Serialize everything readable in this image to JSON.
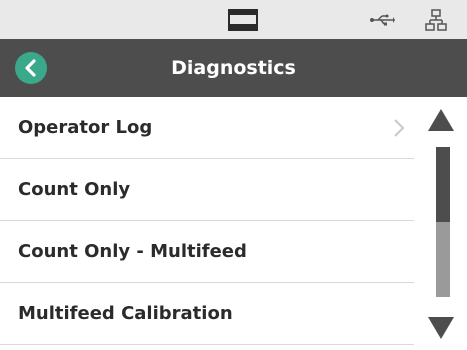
{
  "status_bar": {
    "icons": [
      "window-icon",
      "usb-icon",
      "network-icon"
    ]
  },
  "header": {
    "title": "Diagnostics",
    "back_icon": "chevron-left-icon",
    "accent_color": "#3aa88a",
    "background_color": "#4d4d4d"
  },
  "list": {
    "items": [
      {
        "label": "Operator Log",
        "has_chevron": true
      },
      {
        "label": "Count Only",
        "has_chevron": false
      },
      {
        "label": "Count Only - Multifeed",
        "has_chevron": false
      },
      {
        "label": "Multifeed Calibration",
        "has_chevron": false
      }
    ]
  },
  "scrollbar": {
    "up_icon": "triangle-up-icon",
    "down_icon": "triangle-down-icon",
    "position_fraction": 0.0,
    "visible_fraction": 0.5
  }
}
